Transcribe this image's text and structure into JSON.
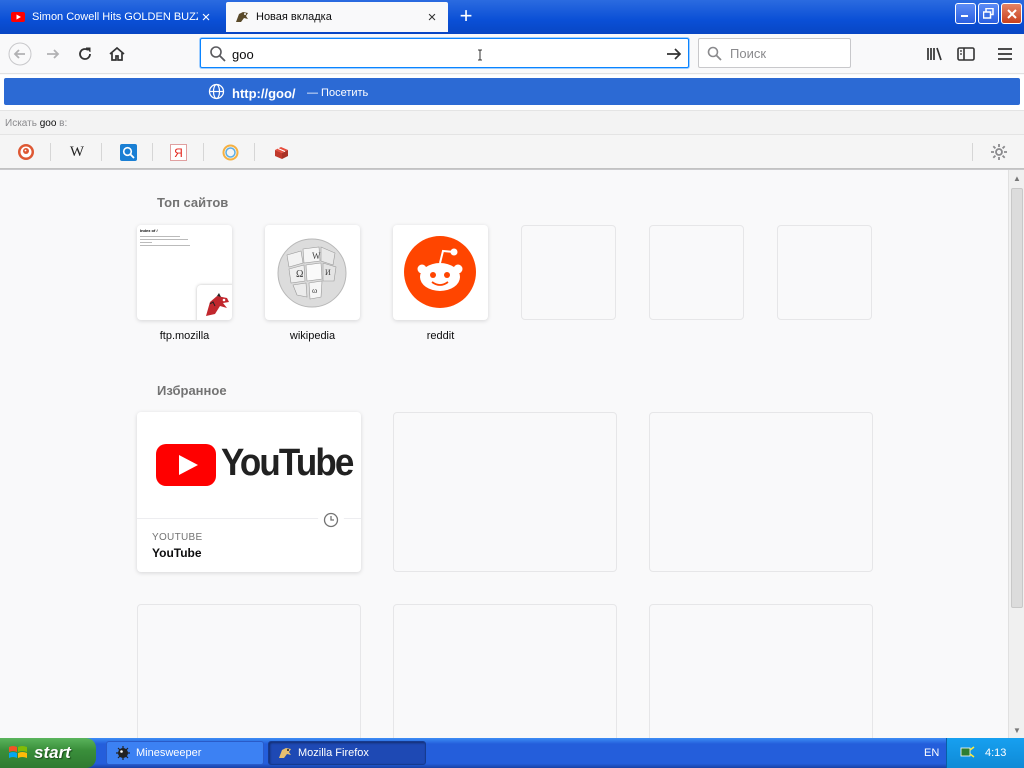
{
  "tabs": [
    {
      "title": "Simon Cowell Hits GOLDEN BUZZER",
      "favicon": "youtube-icon"
    },
    {
      "title": "Новая вкладка",
      "favicon": "firefox-dino-icon"
    }
  ],
  "toolbar": {
    "url_value": "goo",
    "search_placeholder": "Поиск"
  },
  "dropdown": {
    "suggestion_url": "http://goo/",
    "suggestion_action": "— Посетить",
    "search_with_prefix": "Искать",
    "search_with_query": "goo",
    "search_with_suffix": "в:",
    "engines": [
      "duckduckgo-icon",
      "wikipedia-icon",
      "search-icon",
      "yandex-icon",
      "firefox-icon",
      "gift-icon"
    ]
  },
  "content": {
    "top_sites_title": "Топ сайтов",
    "top_sites": [
      {
        "label": "ftp.mozilla"
      },
      {
        "label": "wikipedia"
      },
      {
        "label": "reddit"
      }
    ],
    "highlights_title": "Избранное",
    "youtube_card": {
      "source": "YOUTUBE",
      "title": "YouTube",
      "logo_text": "YouTube"
    },
    "ftp_thumb_text": "Index of /"
  },
  "taskbar": {
    "start_label": "start",
    "tasks": [
      {
        "label": "Minesweeper"
      },
      {
        "label": "Mozilla Firefox"
      }
    ],
    "language": "EN",
    "clock": "4:13"
  },
  "colors": {
    "accent": "#0a84ff",
    "suggestion_bg": "#2c6ad4",
    "youtube_red": "#ff0000",
    "reddit_orange": "#ff4500"
  }
}
